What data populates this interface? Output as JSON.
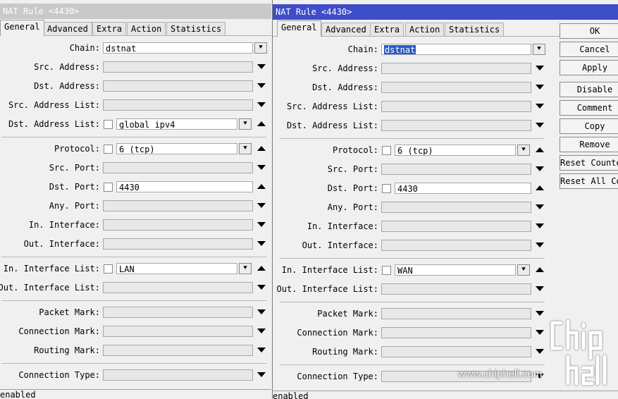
{
  "left": {
    "title": "NAT Rule <4430>",
    "tabs": [
      "General",
      "Advanced",
      "Extra",
      "Action",
      "Statistics"
    ],
    "fields": {
      "chain": {
        "label": "Chain:",
        "value": "dstnat"
      },
      "src_address": {
        "label": "Src. Address:",
        "value": ""
      },
      "dst_address": {
        "label": "Dst. Address:",
        "value": ""
      },
      "src_address_list": {
        "label": "Src. Address List:",
        "value": ""
      },
      "dst_address_list": {
        "label": "Dst. Address List:",
        "value": "global_ipv4"
      },
      "protocol": {
        "label": "Protocol:",
        "value": "6 (tcp)"
      },
      "src_port": {
        "label": "Src. Port:",
        "value": ""
      },
      "dst_port": {
        "label": "Dst. Port:",
        "value": "4430"
      },
      "any_port": {
        "label": "Any. Port:",
        "value": ""
      },
      "in_interface": {
        "label": "In. Interface:",
        "value": ""
      },
      "out_interface": {
        "label": "Out. Interface:",
        "value": ""
      },
      "in_interface_list": {
        "label": "In. Interface List:",
        "value": "LAN"
      },
      "out_interface_list": {
        "label": "Out. Interface List:",
        "value": ""
      },
      "packet_mark": {
        "label": "Packet Mark:",
        "value": ""
      },
      "connection_mark": {
        "label": "Connection Mark:",
        "value": ""
      },
      "routing_mark": {
        "label": "Routing Mark:",
        "value": ""
      },
      "connection_type": {
        "label": "Connection Type:",
        "value": ""
      }
    },
    "status": "enabled"
  },
  "right": {
    "title": "NAT Rule <4430>",
    "tabs": [
      "General",
      "Advanced",
      "Extra",
      "Action",
      "Statistics"
    ],
    "fields": {
      "chain": {
        "label": "Chain:",
        "value": "dstnat"
      },
      "src_address": {
        "label": "Src. Address:",
        "value": ""
      },
      "dst_address": {
        "label": "Dst. Address:",
        "value": ""
      },
      "src_address_list": {
        "label": "Src. Address List:",
        "value": ""
      },
      "dst_address_list": {
        "label": "Dst. Address List:",
        "value": ""
      },
      "protocol": {
        "label": "Protocol:",
        "value": "6 (tcp)"
      },
      "src_port": {
        "label": "Src. Port:",
        "value": ""
      },
      "dst_port": {
        "label": "Dst. Port:",
        "value": "4430"
      },
      "any_port": {
        "label": "Any. Port:",
        "value": ""
      },
      "in_interface": {
        "label": "In. Interface:",
        "value": ""
      },
      "out_interface": {
        "label": "Out. Interface:",
        "value": ""
      },
      "in_interface_list": {
        "label": "In. Interface List:",
        "value": "WAN"
      },
      "out_interface_list": {
        "label": "Out. Interface List:",
        "value": ""
      },
      "packet_mark": {
        "label": "Packet Mark:",
        "value": ""
      },
      "connection_mark": {
        "label": "Connection Mark:",
        "value": ""
      },
      "routing_mark": {
        "label": "Routing Mark:",
        "value": ""
      },
      "connection_type": {
        "label": "Connection Type:",
        "value": ""
      }
    },
    "status": "enabled",
    "buttons": [
      "OK",
      "Cancel",
      "Apply",
      "Disable",
      "Comment",
      "Copy",
      "Remove",
      "Reset Counters",
      "Reset All Counters"
    ]
  },
  "watermark": {
    "text": "www.chiphell.com",
    "logo": "chip hell"
  },
  "colors": {
    "active_title": "#3e4dc9",
    "inactive_title": "#c9c9c9",
    "selection": "#2a5cc7"
  }
}
